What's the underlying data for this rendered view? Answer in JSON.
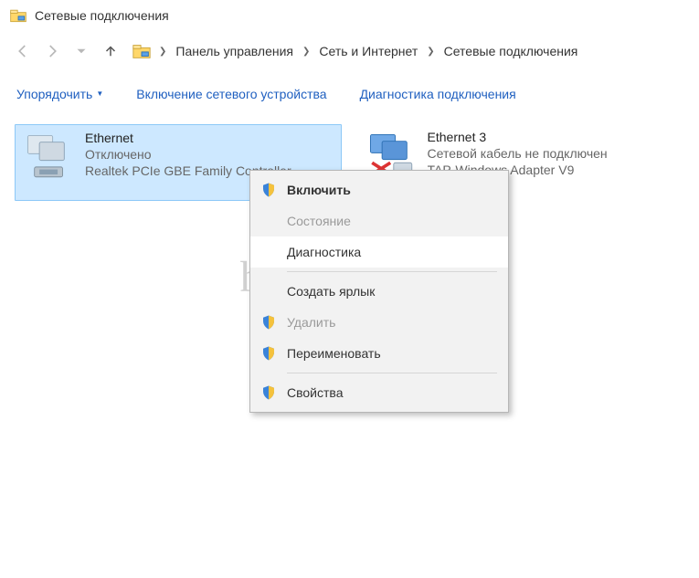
{
  "window": {
    "title": "Сетевые подключения"
  },
  "breadcrumbs": {
    "items": [
      "Панель управления",
      "Сеть и Интернет",
      "Сетевые подключения"
    ]
  },
  "toolbar": {
    "organize": "Упорядочить",
    "enable_device": "Включение сетевого устройства",
    "diagnose": "Диагностика подключения"
  },
  "connections": [
    {
      "name": "Ethernet",
      "status": "Отключено",
      "device": "Realtek PCIe GBE Family Controller",
      "selected": true
    },
    {
      "name": "Ethernet 3",
      "status": "Сетевой кабель не подключен",
      "device": "TAP-Windows Adapter V9",
      "selected": false
    }
  ],
  "context_menu": {
    "enable": {
      "label": "Включить",
      "shield": true,
      "bold": true,
      "disabled": false,
      "hover": false
    },
    "status": {
      "label": "Состояние",
      "shield": false,
      "bold": false,
      "disabled": true,
      "hover": false
    },
    "diagnose": {
      "label": "Диагностика",
      "shield": false,
      "bold": false,
      "disabled": false,
      "hover": true
    },
    "shortcut": {
      "label": "Создать ярлык",
      "shield": false,
      "bold": false,
      "disabled": false,
      "hover": false
    },
    "delete": {
      "label": "Удалить",
      "shield": true,
      "bold": false,
      "disabled": true,
      "hover": false
    },
    "rename": {
      "label": "Переименовать",
      "shield": true,
      "bold": false,
      "disabled": false,
      "hover": false
    },
    "props": {
      "label": "Свойства",
      "shield": true,
      "bold": false,
      "disabled": false,
      "hover": false
    }
  },
  "watermark": "help-wifi.ru"
}
